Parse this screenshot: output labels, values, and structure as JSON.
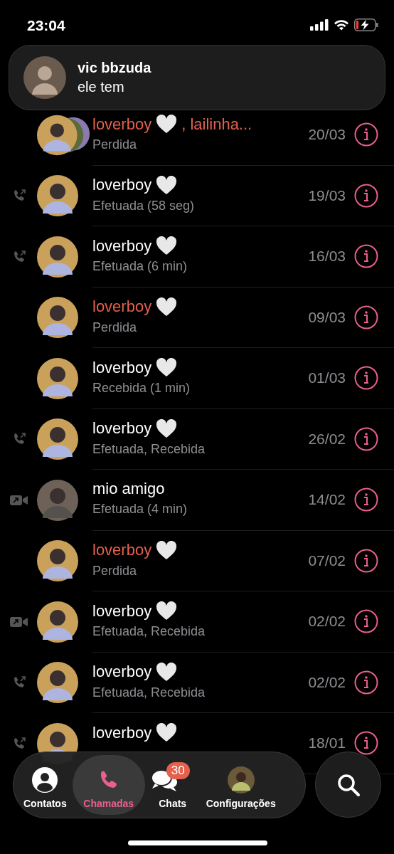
{
  "status_bar": {
    "time": "23:04"
  },
  "notification": {
    "title": "vic bbzuda",
    "body": "ele tem"
  },
  "calls": [
    {
      "name": "loverboy",
      "heart": true,
      "name_suffix": ", lailinha...",
      "group": true,
      "missed": true,
      "kind": "plain",
      "detail": "Perdida",
      "date": "20/03"
    },
    {
      "name": "loverboy",
      "heart": true,
      "group": false,
      "missed": false,
      "kind": "voice",
      "detail": "Efetuada (58 seg)",
      "date": "19/03"
    },
    {
      "name": "loverboy",
      "heart": true,
      "group": false,
      "missed": false,
      "kind": "voice",
      "detail": "Efetuada (6 min)",
      "date": "16/03"
    },
    {
      "name": "loverboy",
      "heart": true,
      "group": false,
      "missed": true,
      "kind": "plain",
      "detail": "Perdida",
      "date": "09/03"
    },
    {
      "name": "loverboy",
      "heart": true,
      "group": false,
      "missed": false,
      "kind": "plain",
      "detail": "Recebida (1 min)",
      "date": "01/03"
    },
    {
      "name": "loverboy",
      "heart": true,
      "group": false,
      "missed": false,
      "kind": "voice",
      "detail": "Efetuada, Recebida",
      "date": "26/02"
    },
    {
      "name": "mio amigo",
      "heart": false,
      "group": false,
      "missed": false,
      "kind": "video",
      "detail": "Efetuada (4 min)",
      "date": "14/02"
    },
    {
      "name": "loverboy",
      "heart": true,
      "group": false,
      "missed": true,
      "kind": "plain",
      "detail": "Perdida",
      "date": "07/02"
    },
    {
      "name": "loverboy",
      "heart": true,
      "group": false,
      "missed": false,
      "kind": "video",
      "detail": "Efetuada, Recebida",
      "date": "02/02"
    },
    {
      "name": "loverboy",
      "heart": true,
      "group": false,
      "missed": false,
      "kind": "voice",
      "detail": "Efetuada, Recebida",
      "date": "02/02"
    },
    {
      "name": "loverboy",
      "heart": true,
      "group": false,
      "missed": false,
      "kind": "voice",
      "date": "18/01"
    }
  ],
  "tabs": [
    {
      "label": "Contatos",
      "kind": "contacts",
      "selected": false
    },
    {
      "label": "Chamadas",
      "kind": "calls",
      "selected": true
    },
    {
      "label": "Chats",
      "kind": "chats",
      "selected": false,
      "badge": "30"
    },
    {
      "label": "Configurações",
      "kind": "settings",
      "selected": false
    }
  ]
}
